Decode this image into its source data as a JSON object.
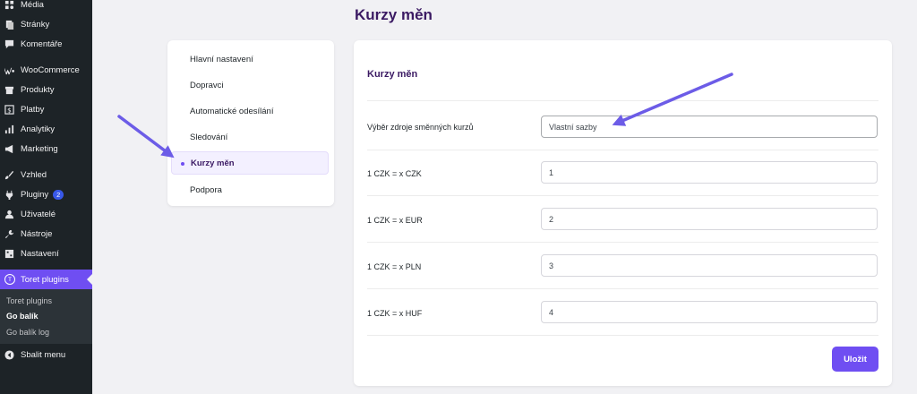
{
  "sidebar": {
    "items": [
      {
        "label": "Média",
        "icon": "media-icon"
      },
      {
        "label": "Stránky",
        "icon": "pages-icon"
      },
      {
        "label": "Komentáře",
        "icon": "comments-icon"
      },
      {
        "label": "WooCommerce",
        "icon": "woocommerce-icon"
      },
      {
        "label": "Produkty",
        "icon": "products-icon"
      },
      {
        "label": "Platby",
        "icon": "payments-icon"
      },
      {
        "label": "Analytiky",
        "icon": "analytics-icon"
      },
      {
        "label": "Marketing",
        "icon": "marketing-icon"
      },
      {
        "label": "Vzhled",
        "icon": "appearance-icon"
      },
      {
        "label": "Pluginy",
        "icon": "plugins-icon",
        "badge": "2"
      },
      {
        "label": "Uživatelé",
        "icon": "users-icon"
      },
      {
        "label": "Nástroje",
        "icon": "tools-icon"
      },
      {
        "label": "Nastavení",
        "icon": "settings-icon"
      }
    ],
    "active": {
      "label": "Toret plugins",
      "icon": "toret-icon",
      "icon_letter": "T"
    },
    "submenu": [
      {
        "label": "Toret plugins"
      },
      {
        "label": "Go balík"
      },
      {
        "label": "Go balík log"
      }
    ],
    "collapse": {
      "label": "Sbalit menu",
      "icon": "collapse-icon"
    }
  },
  "page": {
    "title": "Kurzy měn"
  },
  "nav": {
    "items": [
      {
        "label": "Hlavní nastavení"
      },
      {
        "label": "Dopravci"
      },
      {
        "label": "Automatické odesílání"
      },
      {
        "label": "Sledování"
      },
      {
        "label": "Kurzy měn"
      },
      {
        "label": "Podpora"
      }
    ],
    "active_index": 4
  },
  "form": {
    "title": "Kurzy měn",
    "source": {
      "label": "Výběr zdroje směnných kurzů",
      "value": "Vlastní sazby"
    },
    "rates": [
      {
        "label": "1 CZK = x CZK",
        "value": "1"
      },
      {
        "label": "1 CZK = x EUR",
        "value": "2"
      },
      {
        "label": "1 CZK = x PLN",
        "value": "3"
      },
      {
        "label": "1 CZK = x HUF",
        "value": "4"
      }
    ],
    "save_label": "Uložit"
  },
  "colors": {
    "accent": "#6f4ef2",
    "title": "#3b1a63",
    "sidebar_bg": "#1d2327",
    "annotation_arrow": "#6c5ce7"
  }
}
